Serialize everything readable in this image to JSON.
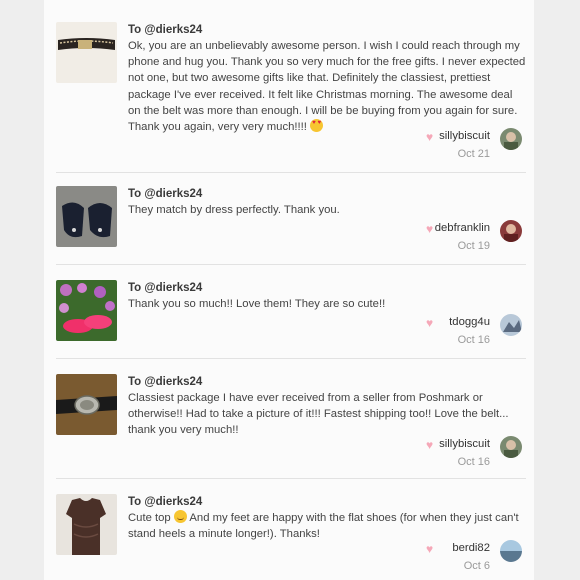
{
  "reviews": [
    {
      "to": "To @dierks24",
      "message_parts": [
        "Ok, you are an unbelievably awesome person. I wish I could reach through my phone and hug you. Thank you so very much for the free gifts. I never expected not one, but two awesome gifts like that. Definitely the classiest, prettiest package I've ever received. It felt like Christmas morning. The awesome deal on the belt was more than enough. I will be be buying from you again for sure. Thank you again, very very much!!!! ",
        ""
      ],
      "emoji": "smiling-face-with-heart-eyes-icon",
      "username": "sillybiscuit",
      "date": "Oct 21",
      "thumb": "belt-photo"
    },
    {
      "to": "To @dierks24",
      "message_parts": [
        "They match by dress perfectly. Thank you.",
        ""
      ],
      "username": "debfranklin",
      "date": "Oct 19",
      "thumb": "black-heels-photo"
    },
    {
      "to": "To @dierks24",
      "message_parts": [
        "Thank you so much!! Love them! They are so cute!!",
        ""
      ],
      "username": "tdogg4u",
      "date": "Oct 16",
      "thumb": "pink-shoes-photo"
    },
    {
      "to": "To @dierks24",
      "message_parts": [
        "Classiest package I have ever received from a seller from Poshmark or otherwise!! Had to take a picture of it!!! Fastest shipping too!! Love the belt... thank you very much!!",
        ""
      ],
      "username": "sillybiscuit",
      "date": "Oct 16",
      "thumb": "buckle-belt-photo"
    },
    {
      "to": "To @dierks24",
      "message_parts": [
        "Cute top ",
        " And my feet are happy with the flat shoes (for when they just can't stand heels a minute longer!). Thanks!"
      ],
      "emoji": "smirking-face-icon",
      "username": "berdi82",
      "date": "Oct 6",
      "thumb": "brown-top-photo"
    }
  ],
  "colors": {
    "heart": "#f5a8b8",
    "panel_bg": "#fbfbfb",
    "page_bg": "#eeeeee"
  }
}
